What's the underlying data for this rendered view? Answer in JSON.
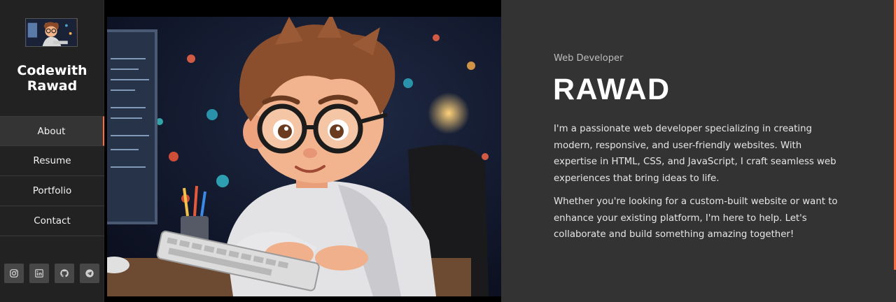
{
  "brand": {
    "name": "Codewith Rawad"
  },
  "nav": {
    "items": [
      {
        "label": "About"
      },
      {
        "label": "Resume"
      },
      {
        "label": "Portfolio"
      },
      {
        "label": "Contact"
      }
    ]
  },
  "socials": [
    "instagram-icon",
    "linkedin-icon",
    "github-icon",
    "telegram-icon"
  ],
  "hero": {
    "role": "Web Developer",
    "name": "RAWAD"
  },
  "about": {
    "paragraph1": "I'm a passionate web developer specializing in creating modern, responsive, and user-friendly websites. With expertise in HTML, CSS, and JavaScript, I craft seamless web experiences that bring ideas to life.",
    "paragraph2": "Whether you're looking for a custom-built website or want to enhance your existing platform, I'm here to help. Let's collaborate and build something amazing together!"
  },
  "colors": {
    "accent": "#ff6b3d",
    "sidebar": "#222222",
    "content_bg": "#333333"
  }
}
